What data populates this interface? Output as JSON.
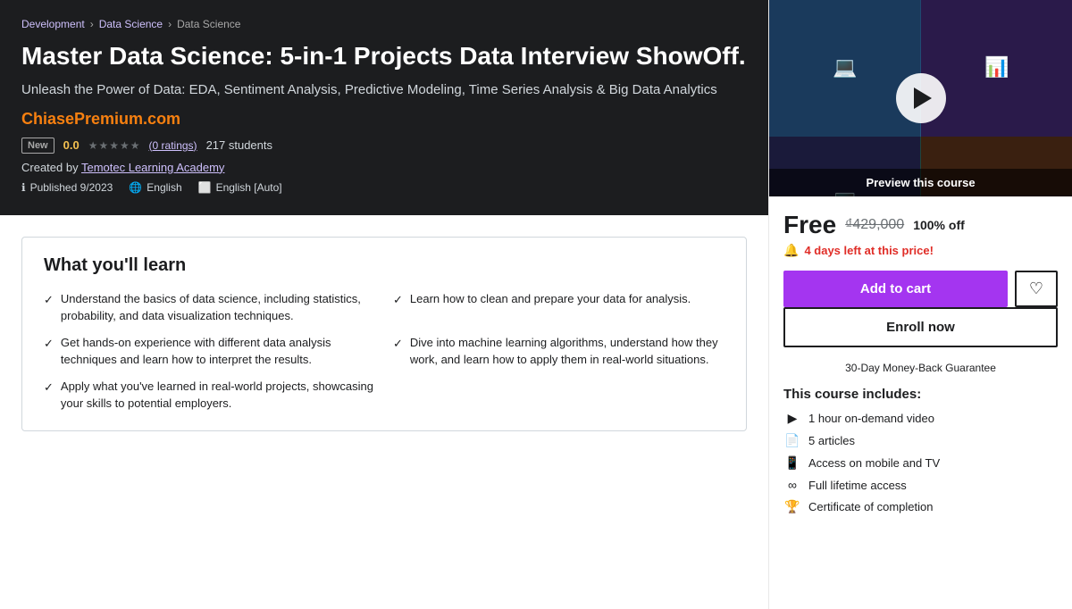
{
  "breadcrumb": {
    "items": [
      "Development",
      "Data Science",
      "Data Science"
    ]
  },
  "hero": {
    "title": "Master Data Science: 5-in-1 Projects Data Interview ShowOff.",
    "subtitle": "Unleash the Power of Data: EDA, Sentiment Analysis, Predictive Modeling, Time Series Analysis & Big Data Analytics",
    "watermark": "ChiasePremium.com",
    "badge": "New",
    "rating": "0.0",
    "rating_count": "(0 ratings)",
    "students": "217 students",
    "creator_prefix": "Created by",
    "creator_name": "Temotec Learning Academy",
    "published_label": "Published 9/2023",
    "language": "English",
    "caption": "English [Auto]"
  },
  "preview": {
    "label": "Preview this course"
  },
  "pricing": {
    "price_free": "Free",
    "price_original": "₫429,000",
    "discount": "100% off",
    "urgency": "4 days left at this price!"
  },
  "buttons": {
    "add_to_cart": "Add to cart",
    "enroll_now": "Enroll now",
    "money_back": "30-Day Money-Back Guarantee"
  },
  "course_includes": {
    "heading": "This course includes:",
    "items": [
      {
        "icon": "video",
        "text": "1 hour on-demand video"
      },
      {
        "icon": "article",
        "text": "5 articles"
      },
      {
        "icon": "mobile",
        "text": "Access on mobile and TV"
      },
      {
        "icon": "infinity",
        "text": "Full lifetime access"
      },
      {
        "icon": "certificate",
        "text": "Certificate of completion"
      }
    ]
  },
  "learn_section": {
    "heading": "What you'll learn",
    "items": [
      "Understand the basics of data science, including statistics, probability, and data visualization techniques.",
      "Get hands-on experience with different data analysis techniques and learn how to interpret the results.",
      "Apply what you've learned in real-world projects, showcasing your skills to potential employers.",
      "Learn how to clean and prepare your data for analysis.",
      "Dive into machine learning algorithms, understand how they work, and learn how to apply them in real-world situations."
    ]
  }
}
